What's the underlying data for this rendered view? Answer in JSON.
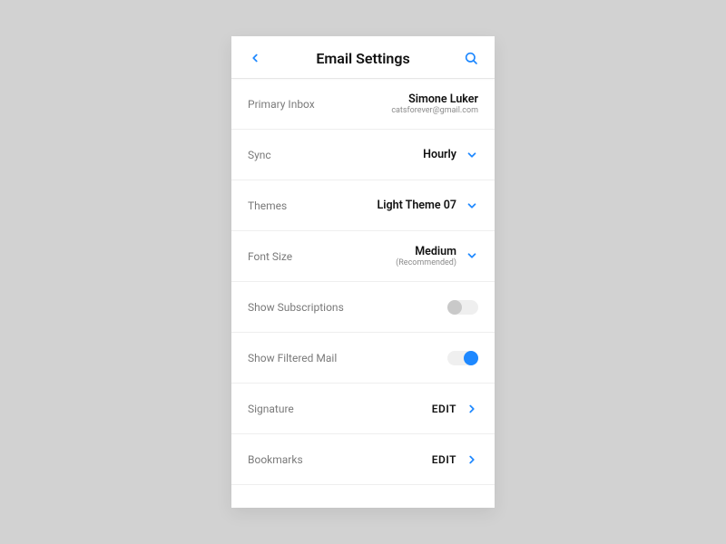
{
  "header": {
    "title": "Email Settings"
  },
  "rows": {
    "primary_inbox": {
      "label": "Primary Inbox",
      "name": "Simone Luker",
      "email": "catsforever@gmail.com"
    },
    "sync": {
      "label": "Sync",
      "value": "Hourly"
    },
    "themes": {
      "label": "Themes",
      "value": "Light Theme 07"
    },
    "font_size": {
      "label": "Font Size",
      "value": "Medium",
      "hint": "(Recommended)"
    },
    "show_subscriptions": {
      "label": "Show Subscriptions",
      "on": false
    },
    "show_filtered": {
      "label": "Show Filtered Mail",
      "on": true
    },
    "signature": {
      "label": "Signature",
      "action": "EDIT"
    },
    "bookmarks": {
      "label": "Bookmarks",
      "action": "EDIT"
    }
  }
}
